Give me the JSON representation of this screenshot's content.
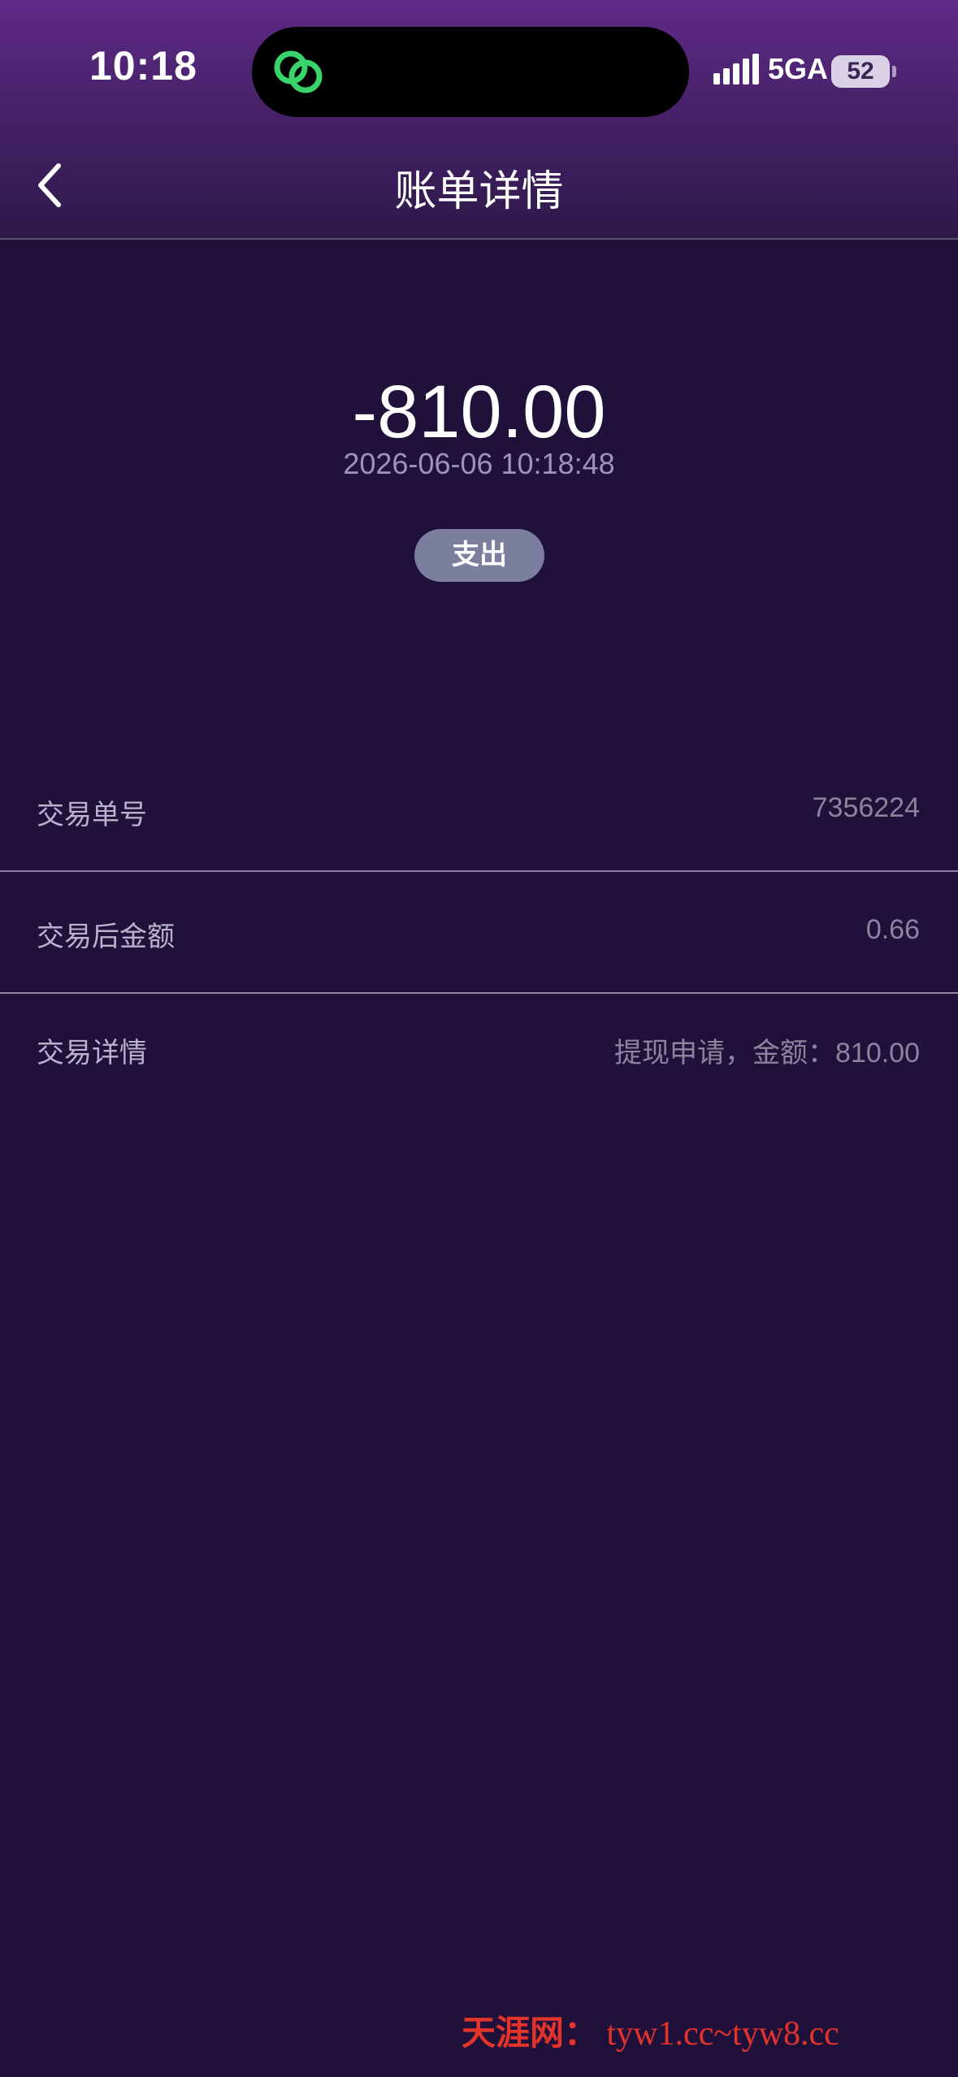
{
  "status_bar": {
    "time": "10:18",
    "network": "5GA",
    "battery": "52",
    "icons": [
      "signal-icon",
      "battery-icon",
      "app-link-icon"
    ]
  },
  "nav": {
    "title": "账单详情",
    "back_icon": "chevron-left-icon"
  },
  "summary": {
    "amount": "-810.00",
    "datetime": "2026-06-06 10:18:48",
    "type_badge": "支出"
  },
  "details": [
    {
      "label": "交易单号",
      "value": "7356224"
    },
    {
      "label": "交易后金额",
      "value": "0.66"
    },
    {
      "label": "交易详情",
      "value": "提现申请，金额：810.00"
    }
  ],
  "watermark": {
    "cn": "天涯网：",
    "url": "tyw1.cc~tyw8.cc"
  },
  "colors": {
    "background": "#1f113a",
    "header_gradient_top": "#5e2a86",
    "badge": "#7b7f9d",
    "watermark": "#e3342c",
    "island_icon": "#3ad36b"
  }
}
